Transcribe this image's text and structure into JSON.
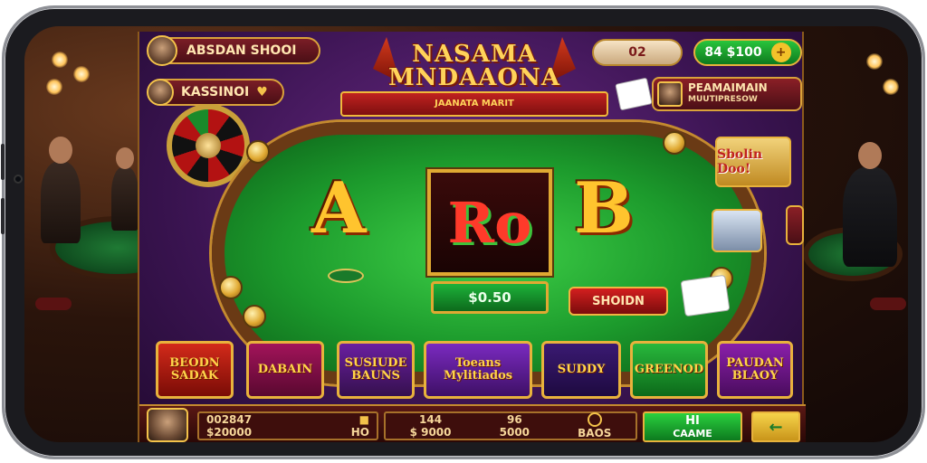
{
  "header": {
    "player_name": "ABSDAN SHOOI",
    "casino_name": "KASSINOI",
    "balance_pill": "02",
    "cash_pill": "84 $100",
    "promo_title": "PEAMAIMAIN",
    "promo_sub": "MUUTIPRESOW",
    "title_line1": "NASAMA",
    "title_line2": "MNDAAONA",
    "ribbon_text": "JAANATA MARIT"
  },
  "table": {
    "left_letter": "A",
    "center_symbol": "Ro",
    "right_letter": "B",
    "value_plate": "$0.50",
    "action_button": "SHOIDN"
  },
  "side": {
    "card_label": "Sbolin Doo!"
  },
  "games": [
    {
      "label": "BEODN SADAK"
    },
    {
      "label": "DABAIN"
    },
    {
      "label": "SUSIUDE BAUNS"
    },
    {
      "label": "Toeans Mylitiados"
    },
    {
      "label": "SUDDY"
    },
    {
      "label": "GREENOD"
    },
    {
      "label": "PAUDAN BLAOY"
    }
  ],
  "bottom": {
    "left_stat_top": "002847",
    "left_stat_bottom": "$20000",
    "left_mid_label": "HO",
    "mid_stat_1_top": "144",
    "mid_stat_1_bottom": "$ 9000",
    "mid_stat_2_top": "96",
    "mid_stat_2_bottom": "5000",
    "mid_stat_3_bottom": "BAOS",
    "green_button_top": "HI",
    "green_button_bottom": "CAAME",
    "arrow_button": "←"
  },
  "colors": {
    "felt": "#2bb23a",
    "gold": "#e0a932",
    "purple": "#4b1a66",
    "red": "#b31212"
  },
  "icons": {
    "plus": "+",
    "heart": "♥",
    "cards": "🂡"
  }
}
